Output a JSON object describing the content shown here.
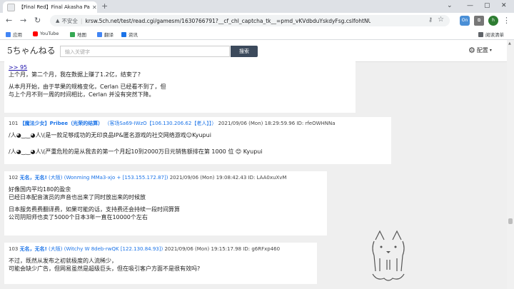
{
  "browser": {
    "tab_title": "【Final Red】Final Akasha Par",
    "insecure_label": "不安全",
    "url": "krsw.5ch.net/test/read.cgi/gamesm/1630766791?__cf_chl_captcha_tk__=pmd_vKVdbduYskdyFsg.csIfohtNU_O8Wr28NnETghiHo...",
    "bookmarks": [
      "应用",
      "YouTube",
      "地图",
      "翻译",
      "资讯"
    ],
    "reading_list": "阅读清单",
    "avatar_letter": "h",
    "ext_label": "On"
  },
  "site": {
    "search_placeholder": "输入关键字",
    "search_button": "搜索",
    "config_label": "配置"
  },
  "posts": [
    {
      "reply_link": ">> 95",
      "lines": [
        "上个月，第二个月，我在数据上赚了1.2亿，结束了?",
        "",
        "从本月开始，由于苹果的规格变化，Cerlan 已经看不到了，但",
        "与上个月不到一周的时间相比，Cerlan 并没有突然下降。"
      ]
    },
    {
      "num": "101",
      "name": "【魔法少女】Pribee（光荣的结算）",
      "trip": "（客场Sa69-IWzO【106.130.206.62【老人】】）",
      "date": "2021/09/06 (Mon) 18:29:59.96",
      "id": "ID: rfeOWHNNa",
      "lines": [
        "/人◕‿‿◕人\\(是一款足够成功的无印良品IP&匿名游戏的社交网络游戏☺Kyupui",
        "",
        "/人◕‿‿◕人\\(严重危险的是从我去的第一个月起10到2000万日元销售额排在第 1000 位 😊 Kyupui"
      ]
    },
    {
      "num": "102",
      "name": "无名，无名!",
      "trip": "(大阪) (Wonming MMa3-xjo + [153.155.172.87])",
      "date": "2021/09/06 (Mon) 19:08:42.43",
      "id": "ID: LAA0xuXvM",
      "lines": [
        "好像国内平均180的盈余",
        "已经日本配音演员的声音也出来了同时放出来的时候放",
        "",
        "日本服务费费翻译费，如果可能的话，支持费还会持续一段时间算算",
        "公司阴阳师也卖了5000个日本3年一直在10000个左右"
      ]
    },
    {
      "num": "103",
      "name": "无名，无名!",
      "trip": "(大阪) (Witchy W 8deb-rwQK [122.130.84.93])",
      "date": "2021/09/06 (Mon) 19:15:17.98",
      "id": "ID: g6RFxp460",
      "lines": [
        "不过，既然从发布之初就极度的人流稀少，",
        "可能会缺少广告，但网易虽然是超级巨头，但在吸引客户方面不是很有效吗?"
      ]
    }
  ],
  "colors": {
    "accent": "#1a73e8",
    "search_button": "#3c4a5c",
    "tab_bar": "#dee1e6"
  }
}
